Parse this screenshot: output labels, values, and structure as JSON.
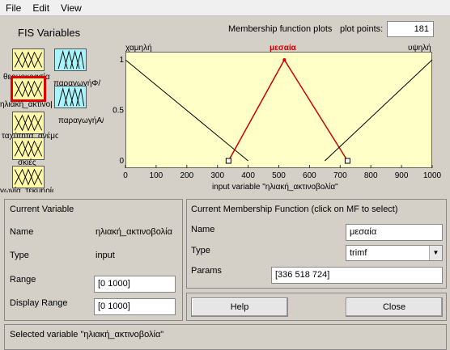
{
  "menu": [
    "File",
    "Edit",
    "View"
  ],
  "fis_title": "FIS Variables",
  "variables": [
    {
      "label": "θερμοκρασία"
    },
    {
      "label": "ηλιακή_ακτινοβολία"
    },
    {
      "label": "ταχύτητα_ανέμου"
    },
    {
      "label": "σκιές"
    },
    {
      "label": "γωνία_τεκμηρίου"
    },
    {
      "label": "παραγωγήΦ/Β"
    },
    {
      "label": "παραγωγήΑ/Γ"
    }
  ],
  "plot": {
    "title": "Membership function plots",
    "points_label": "plot points:",
    "points_value": "181",
    "axis_title": "input variable \"ηλιακή_ακτινοβολία\""
  },
  "chart_data": {
    "type": "line",
    "xlim": [
      0,
      1000
    ],
    "ylim": [
      0,
      1
    ],
    "x_ticks": [
      0,
      100,
      200,
      300,
      400,
      500,
      600,
      700,
      800,
      900,
      1000
    ],
    "y_ticks": [
      0,
      0.5,
      1
    ],
    "y_tick_labels": [
      "0",
      "0.5",
      "1"
    ],
    "series": [
      {
        "name": "χαμηλή",
        "points": [
          [
            0,
            1
          ],
          [
            400,
            0
          ]
        ],
        "color": "#000000",
        "selected": false
      },
      {
        "name": "μεσαία",
        "points": [
          [
            336,
            0
          ],
          [
            518,
            1
          ],
          [
            724,
            0
          ]
        ],
        "color": "#cc0000",
        "selected": true
      },
      {
        "name": "υψηλή",
        "points": [
          [
            650,
            0
          ],
          [
            1000,
            1
          ]
        ],
        "color": "#000000",
        "selected": false
      }
    ],
    "selected_handles": [
      [
        336,
        0
      ],
      [
        724,
        0
      ]
    ]
  },
  "current_variable": {
    "header": "Current Variable",
    "name_label": "Name",
    "name_value": "ηλιακή_ακτινοβολία",
    "type_label": "Type",
    "type_value": "input",
    "range_label": "Range",
    "range_value": "[0 1000]",
    "display_range_label": "Display Range",
    "display_range_value": "[0 1000]"
  },
  "current_mf": {
    "header": "Current Membership Function (click on MF to select)",
    "name_label": "Name",
    "name_value": "μεσαία",
    "type_label": "Type",
    "type_value": "trimf",
    "params_label": "Params",
    "params_value": "[336 518 724]"
  },
  "buttons": {
    "help": "Help",
    "close": "Close"
  },
  "status": "Selected variable \"ηλιακή_ακτινοβολία\""
}
